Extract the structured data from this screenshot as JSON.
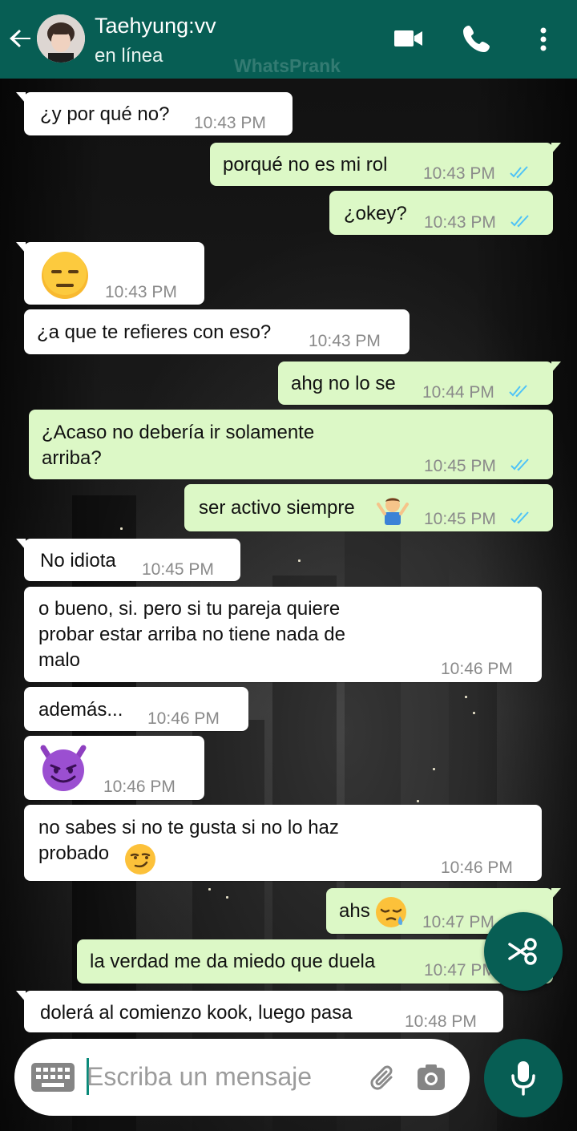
{
  "colors": {
    "header": "#075e54",
    "incoming_bubble": "#ffffff",
    "outgoing_bubble": "#dcf8c6",
    "read_ticks": "#4fc3f7"
  },
  "header": {
    "contact_name": "Taehyung:vv",
    "status": "en línea",
    "watermark": "WhatsPrank",
    "icons": [
      "back-arrow-icon",
      "video-call-icon",
      "phone-icon",
      "more-vert-icon"
    ]
  },
  "messages": [
    {
      "direction": "in",
      "text": "¿y por qué no?",
      "time": "10:43 PM"
    },
    {
      "direction": "out",
      "text": "porqué no es mi rol",
      "time": "10:43 PM",
      "read": true
    },
    {
      "direction": "out",
      "text": "¿okey?",
      "time": "10:43 PM",
      "read": true
    },
    {
      "direction": "in",
      "emoji": "😑",
      "time": "10:43 PM"
    },
    {
      "direction": "in",
      "text": "¿a que te refieres con eso?",
      "time": "10:43 PM"
    },
    {
      "direction": "out",
      "text": "ahg no lo se",
      "time": "10:44 PM",
      "read": true
    },
    {
      "direction": "out",
      "text": "¿Acaso no debería ir solamente\narriba?",
      "time": "10:45 PM",
      "read": true
    },
    {
      "direction": "out",
      "text": "ser activo siempre",
      "emoji": "🤷‍♂️",
      "time": "10:45 PM",
      "read": true
    },
    {
      "direction": "in",
      "text": "No idiota",
      "time": "10:45 PM"
    },
    {
      "direction": "in",
      "text": "o bueno, si. pero si tu pareja quiere\nprobar estar arriba no tiene nada de\nmalo",
      "time": "10:46 PM"
    },
    {
      "direction": "in",
      "text": "además...",
      "time": "10:46 PM"
    },
    {
      "direction": "in",
      "emoji": "😈",
      "time": "10:46 PM"
    },
    {
      "direction": "in",
      "text": "no sabes si no te gusta si no lo haz\nprobado",
      "emoji": "😏",
      "time": "10:46 PM"
    },
    {
      "direction": "out",
      "text": "ahs",
      "emoji": "😪",
      "time": "10:47 PM"
    },
    {
      "direction": "out",
      "text": "la verdad me da miedo que duela",
      "time": "10:47 PM"
    },
    {
      "direction": "in",
      "text": "dolerá al comienzo kook, luego pasa",
      "time": "10:48 PM"
    }
  ],
  "composer": {
    "placeholder": "Escriba un mensaje",
    "icons": [
      "keyboard-icon",
      "attach-icon",
      "camera-icon",
      "mic-icon"
    ]
  },
  "fab": {
    "icon": "scissors-icon"
  }
}
